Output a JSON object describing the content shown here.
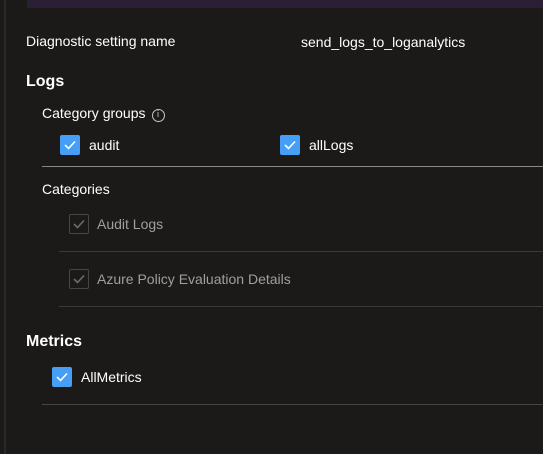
{
  "diagnostic": {
    "name_label": "Diagnostic setting name",
    "name_value": "send_logs_to_loganalytics"
  },
  "logs": {
    "title": "Logs",
    "category_groups": {
      "title": "Category groups",
      "info_icon": "info-icon",
      "items": [
        {
          "label": "audit",
          "checked": true
        },
        {
          "label": "allLogs",
          "checked": true
        }
      ]
    },
    "categories": {
      "title": "Categories",
      "items": [
        {
          "label": "Audit Logs",
          "checked": true,
          "disabled": true
        },
        {
          "label": "Azure Policy Evaluation Details",
          "checked": true,
          "disabled": true
        }
      ]
    }
  },
  "metrics": {
    "title": "Metrics",
    "items": [
      {
        "label": "AllMetrics",
        "checked": true
      }
    ]
  },
  "colors": {
    "background": "#1b1a19",
    "checkbox_accent": "#479ef5",
    "disabled_text": "#a19f9d",
    "divider": "#3b3a39"
  }
}
